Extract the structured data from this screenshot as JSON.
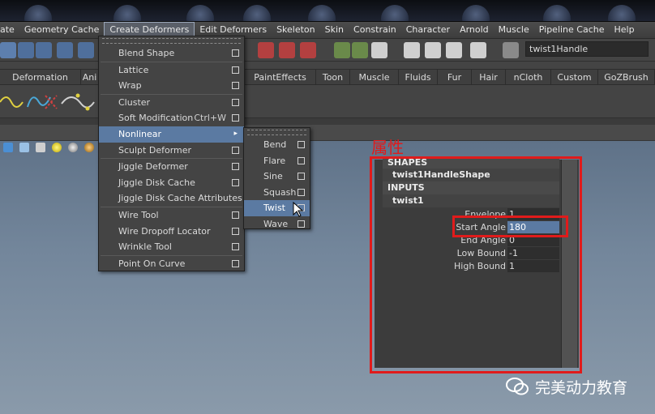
{
  "menubar": {
    "items": [
      "ate",
      "Geometry Cache",
      "Create Deformers",
      "Edit Deformers",
      "Skeleton",
      "Skin",
      "Constrain",
      "Character",
      "Arnold",
      "Muscle",
      "Pipeline Cache",
      "Help"
    ]
  },
  "toolbar": {
    "name_field": "twist1Handle"
  },
  "shelf_tabs": [
    "Deformation",
    "Ani",
    "PaintEffects",
    "Toon",
    "Muscle",
    "Fluids",
    "Fur",
    "Hair",
    "nCloth",
    "Custom",
    "GoZBrush"
  ],
  "create_deformers_menu": {
    "items": [
      {
        "label": "Blend Shape",
        "option_box": true
      },
      {
        "label": "Lattice",
        "option_box": true
      },
      {
        "label": "Wrap",
        "option_box": true
      },
      {
        "label": "Cluster",
        "option_box": true
      },
      {
        "label": "Soft Modification",
        "shortcut": "Ctrl+W",
        "option_box": true
      },
      {
        "label": "Nonlinear",
        "submenu": true,
        "highlighted": true
      },
      {
        "label": "Sculpt Deformer",
        "option_box": true
      },
      {
        "label": "Jiggle Deformer",
        "option_box": true
      },
      {
        "label": "Jiggle Disk Cache",
        "option_box": true
      },
      {
        "label": "Jiggle Disk Cache Attributes",
        "option_box": false
      },
      {
        "label": "Wire Tool",
        "option_box": true
      },
      {
        "label": "Wire Dropoff Locator",
        "option_box": true
      },
      {
        "label": "Wrinkle Tool",
        "option_box": true
      },
      {
        "label": "Point On Curve",
        "option_box": true
      }
    ]
  },
  "nonlinear_submenu": {
    "items": [
      {
        "label": "Bend"
      },
      {
        "label": "Flare"
      },
      {
        "label": "Sine"
      },
      {
        "label": "Squash"
      },
      {
        "label": "Twist",
        "highlighted": true
      },
      {
        "label": "Wave"
      }
    ]
  },
  "annotation": "属性",
  "attribute_editor": {
    "shapes_header": "SHAPES",
    "shape_name": "twist1HandleShape",
    "inputs_header": "INPUTS",
    "input_name": "twist1",
    "attributes": [
      {
        "label": "Envelope",
        "value": "1"
      },
      {
        "label": "Start Angle",
        "value": "180",
        "selected": true
      },
      {
        "label": "End Angle",
        "value": "0"
      },
      {
        "label": "Low Bound",
        "value": "-1"
      },
      {
        "label": "High Bound",
        "value": "1"
      }
    ]
  },
  "watermark": "完美动力教育",
  "colors": {
    "highlight": "#5b7aa2",
    "annotation_red": "#e01b1b",
    "viewport_top": "#5f7288"
  }
}
